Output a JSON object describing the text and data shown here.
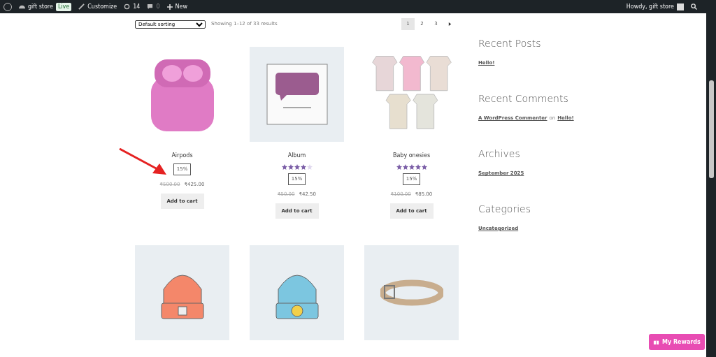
{
  "admin_bar": {
    "site": "gift store",
    "live_badge": "Live",
    "customize": "Customize",
    "updates": "14",
    "comments": "0",
    "new": "New",
    "greeting": "Howdy, gift store"
  },
  "toolbar": {
    "sorting": "Default sorting",
    "result_count": "Showing 1–12 of 33 results",
    "pages": [
      {
        "label": "1",
        "selected": true
      },
      {
        "label": "2",
        "selected": false
      },
      {
        "label": "3",
        "selected": false
      }
    ]
  },
  "products": [
    {
      "title": "Airpods",
      "badge": "15%",
      "old_price": "₹500.00",
      "price": "₹425.00",
      "button": "Add to cart"
    },
    {
      "title": "Album",
      "stars": 4,
      "badge": "15%",
      "old_price": "₹50.00",
      "price": "₹42.50",
      "button": "Add to cart"
    },
    {
      "title": "Baby onesies",
      "stars": 5,
      "badge": "15%",
      "old_price": "₹100.00",
      "price": "₹85.00",
      "button": "Add to cart"
    }
  ],
  "sidebar": [
    {
      "heading": "Recent Posts",
      "links": [
        {
          "text": "Hello!"
        }
      ]
    },
    {
      "heading": "Recent Comments",
      "links": [
        {
          "text": "A WordPress Commenter"
        },
        {
          "text": "on",
          "kind": "plain"
        },
        {
          "text": "Hello!"
        }
      ]
    },
    {
      "heading": "Archives",
      "links": [
        {
          "text": "September 2025"
        }
      ]
    },
    {
      "heading": "Categories",
      "links": [
        {
          "text": "Uncategorized"
        }
      ]
    }
  ],
  "rewards_button": "My Rewards"
}
